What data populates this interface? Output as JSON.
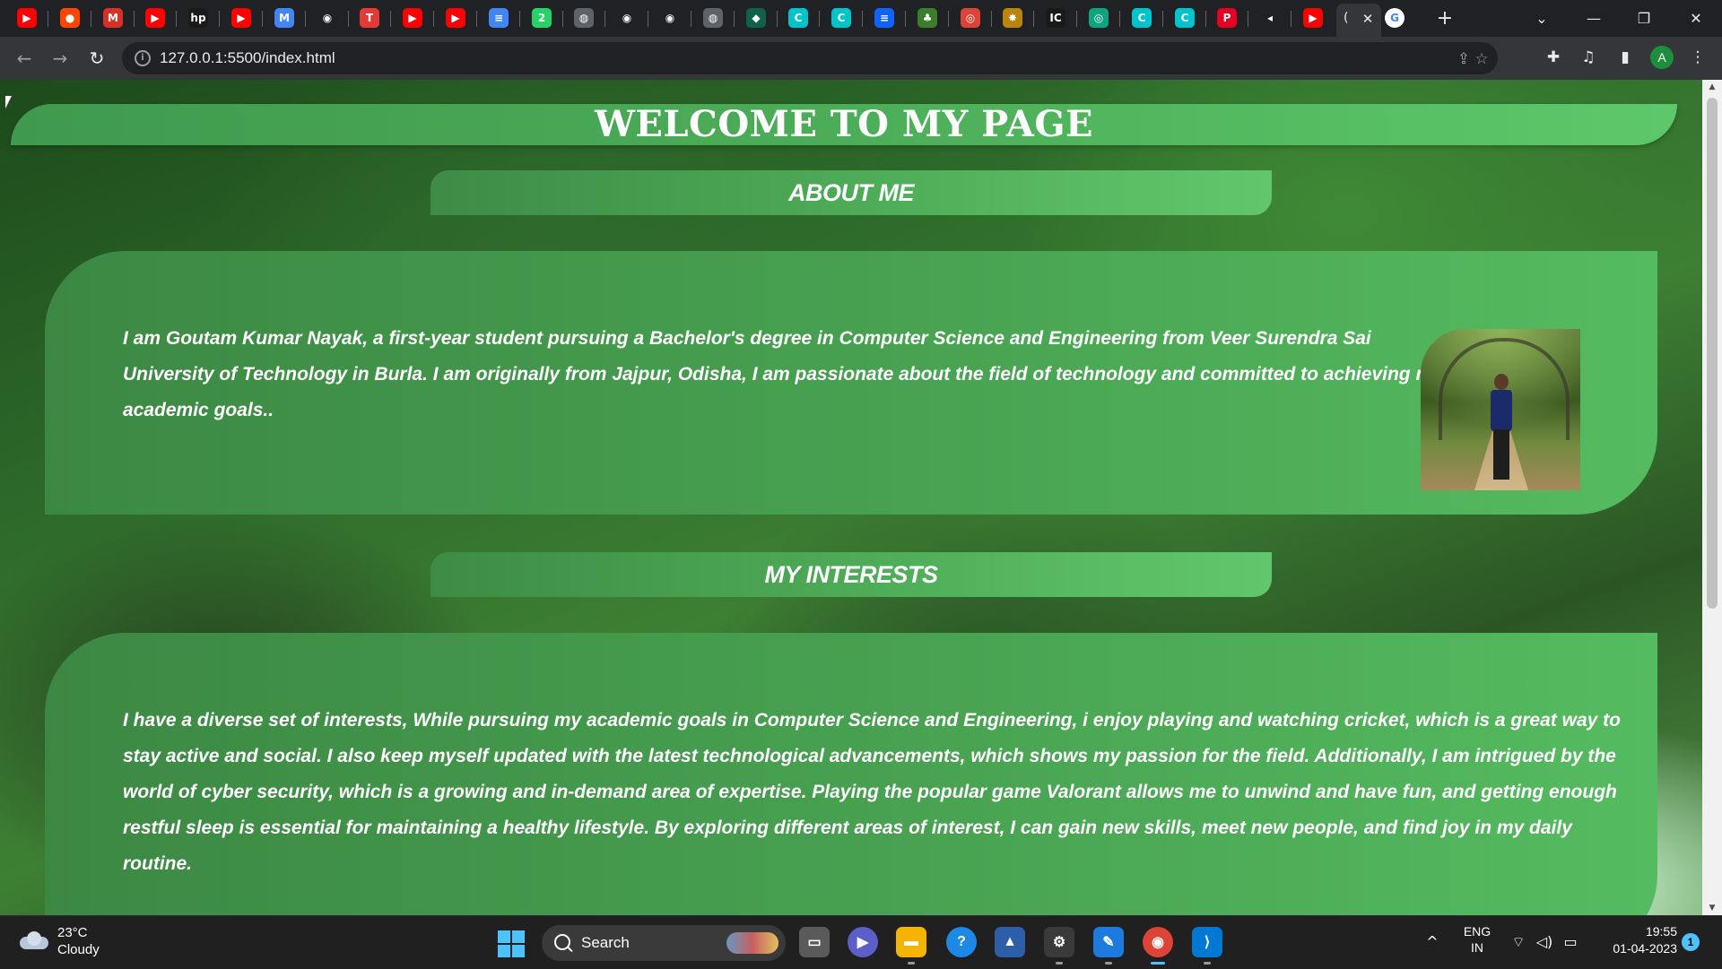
{
  "browser": {
    "tab_icons": [
      {
        "name": "youtube-tab-icon",
        "color": "#ff0000",
        "glyph": "▶"
      },
      {
        "name": "reddit-tab-icon",
        "color": "#ff4500",
        "glyph": "●"
      },
      {
        "name": "gmail-tab-icon",
        "color": "#d93025",
        "glyph": "M"
      },
      {
        "name": "youtube-tab-icon",
        "color": "#ff0000",
        "glyph": "▶"
      },
      {
        "name": "hp-tab-icon",
        "color": "#1a1a1a",
        "glyph": "hp"
      },
      {
        "name": "youtube-tab-icon",
        "color": "#ff0000",
        "glyph": "▶"
      },
      {
        "name": "gmail-tab-icon",
        "color": "#4285f4",
        "glyph": "M"
      },
      {
        "name": "github-tab-icon",
        "color": "#202124",
        "glyph": "◉"
      },
      {
        "name": "tuf-tab-icon",
        "color": "#e53935",
        "glyph": "T"
      },
      {
        "name": "youtube-tab-icon",
        "color": "#ff0000",
        "glyph": "▶"
      },
      {
        "name": "youtube-tab-icon",
        "color": "#ff0000",
        "glyph": "▶"
      },
      {
        "name": "docs-tab-icon",
        "color": "#4285f4",
        "glyph": "≡"
      },
      {
        "name": "whatsapp-tab-icon",
        "color": "#25d366",
        "glyph": "2"
      },
      {
        "name": "globe-tab-icon",
        "color": "#5f6368",
        "glyph": "◍"
      },
      {
        "name": "github-tab-icon",
        "color": "#202124",
        "glyph": "◉"
      },
      {
        "name": "github-tab-icon",
        "color": "#202124",
        "glyph": "◉"
      },
      {
        "name": "globe-tab-icon",
        "color": "#5f6368",
        "glyph": "◍"
      },
      {
        "name": "mongodb-tab-icon",
        "color": "#116149",
        "glyph": "◆"
      },
      {
        "name": "canva-tab-icon",
        "color": "#00c4cc",
        "glyph": "C"
      },
      {
        "name": "canva-tab-icon",
        "color": "#00c4cc",
        "glyph": "C"
      },
      {
        "name": "ibm-tab-icon",
        "color": "#0f62fe",
        "glyph": "≡"
      },
      {
        "name": "leaf-tab-icon",
        "color": "#3a7d2a",
        "glyph": "♣"
      },
      {
        "name": "chrome-app-tab-icon",
        "color": "#db4437",
        "glyph": "◎"
      },
      {
        "name": "sun-tab-icon",
        "color": "#b8860b",
        "glyph": "✸"
      },
      {
        "name": "ic-tab-icon",
        "color": "#1a1a1a",
        "glyph": "IC"
      },
      {
        "name": "chatgpt-tab-icon",
        "color": "#10a37f",
        "glyph": "◎"
      },
      {
        "name": "canva-tab-icon",
        "color": "#00c4cc",
        "glyph": "C"
      },
      {
        "name": "canva-tab-icon",
        "color": "#00c4cc",
        "glyph": "C"
      },
      {
        "name": "pinterest-tab-icon",
        "color": "#e60023",
        "glyph": "P"
      },
      {
        "name": "audio-tab-icon",
        "color": "#202124",
        "glyph": "◂"
      },
      {
        "name": "youtube-tab-icon",
        "color": "#ff0000",
        "glyph": "▶"
      }
    ],
    "new_tab_label": "+",
    "url": "127.0.0.1:5500/index.html"
  },
  "page": {
    "welcome_title": "WELCOME TO MY PAGE",
    "about": {
      "heading": "ABOUT ME",
      "text": "I am Goutam Kumar Nayak, a first-year student pursuing a Bachelor's degree in Computer Science and Engineering from Veer Surendra Sai University of Technology in Burla. I am originally from Jajpur, Odisha, I am passionate about the field of technology and committed to achieving my academic goals.."
    },
    "interests": {
      "heading": "MY INTERESTS",
      "text": "I have a diverse set of interests, While pursuing my academic goals in Computer Science and Engineering, i enjoy playing and watching cricket, which is a great way to stay active and social. I also keep myself updated with the latest technological advancements, which shows my passion for the field. Additionally, I am intrigued by the world of cyber security, which is a growing and in-demand area of expertise. Playing the popular game Valorant allows me to unwind and have fun, and getting enough restful sleep is essential for maintaining a healthy lifestyle. By exploring different areas of interest, I can gain new skills, meet new people, and find joy in my daily routine."
    }
  },
  "taskbar": {
    "weather_temp": "23°C",
    "weather_condition": "Cloudy",
    "search_label": "Search",
    "language_top": "ENG",
    "language_bottom": "IN",
    "time": "19:55",
    "date": "01-04-2023",
    "notification_count": "1"
  },
  "colors": {
    "banner": "#4cad58",
    "card": "#47a050",
    "chrome_dark": "#202124",
    "taskbar": "#202020"
  }
}
